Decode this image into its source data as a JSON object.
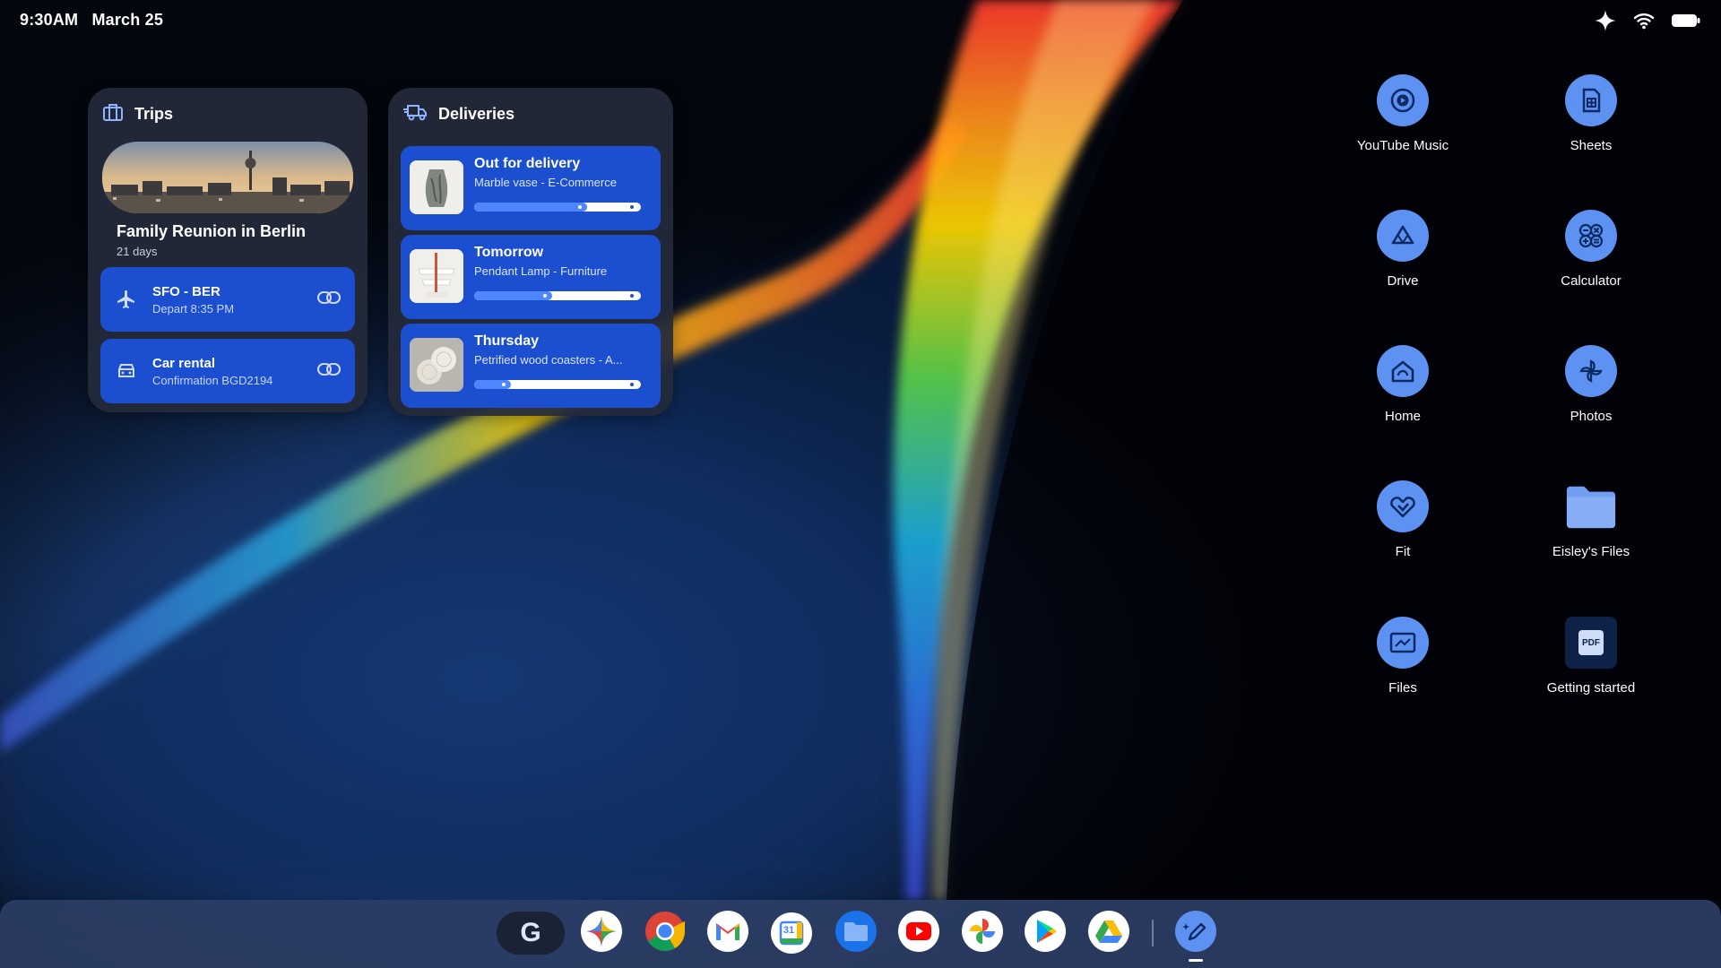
{
  "status_bar": {
    "time": "9:30AM",
    "date": "March 25"
  },
  "trips_widget": {
    "title": "Trips",
    "trip_title": "Family Reunion in Berlin",
    "trip_days": "21 days",
    "flight": {
      "route": "SFO - BER",
      "detail": "Depart 8:35 PM"
    },
    "car": {
      "title": "Car rental",
      "detail": "Confirmation BGD2194"
    }
  },
  "deliveries_widget": {
    "title": "Deliveries",
    "items": [
      {
        "status": "Out for delivery",
        "item": "Marble vase - E-Commerce",
        "progress": 0.68
      },
      {
        "status": "Tomorrow",
        "item": "Pendant Lamp - Furniture",
        "progress": 0.47
      },
      {
        "status": "Thursday",
        "item": "Petrified wood coasters - A...",
        "progress": 0.22
      }
    ]
  },
  "desktop_apps": [
    {
      "label": "YouTube Music",
      "icon": "youtube-music-icon"
    },
    {
      "label": "Sheets",
      "icon": "sheets-icon"
    },
    {
      "label": "Drive",
      "icon": "drive-icon"
    },
    {
      "label": "Calculator",
      "icon": "calculator-icon"
    },
    {
      "label": "Home",
      "icon": "home-icon"
    },
    {
      "label": "Photos",
      "icon": "photos-icon"
    },
    {
      "label": "Fit",
      "icon": "fit-icon"
    },
    {
      "label": "Eisley's Files",
      "icon": "folder-icon"
    },
    {
      "label": "Files",
      "icon": "files-icon"
    },
    {
      "label": "Getting started",
      "icon": "pdf-icon"
    }
  ],
  "shelf": {
    "launcher_letter": "G",
    "calendar_day": "31",
    "pdf_badge": "PDF",
    "apps": [
      "launcher",
      "gemini",
      "chrome",
      "gmail",
      "calendar",
      "files",
      "youtube",
      "photos",
      "play-store",
      "drive",
      "canvas"
    ]
  },
  "colors": {
    "accent": "#1c4fd0",
    "icon_blue": "#5e92f2",
    "widget_bg": "#242a3a"
  }
}
